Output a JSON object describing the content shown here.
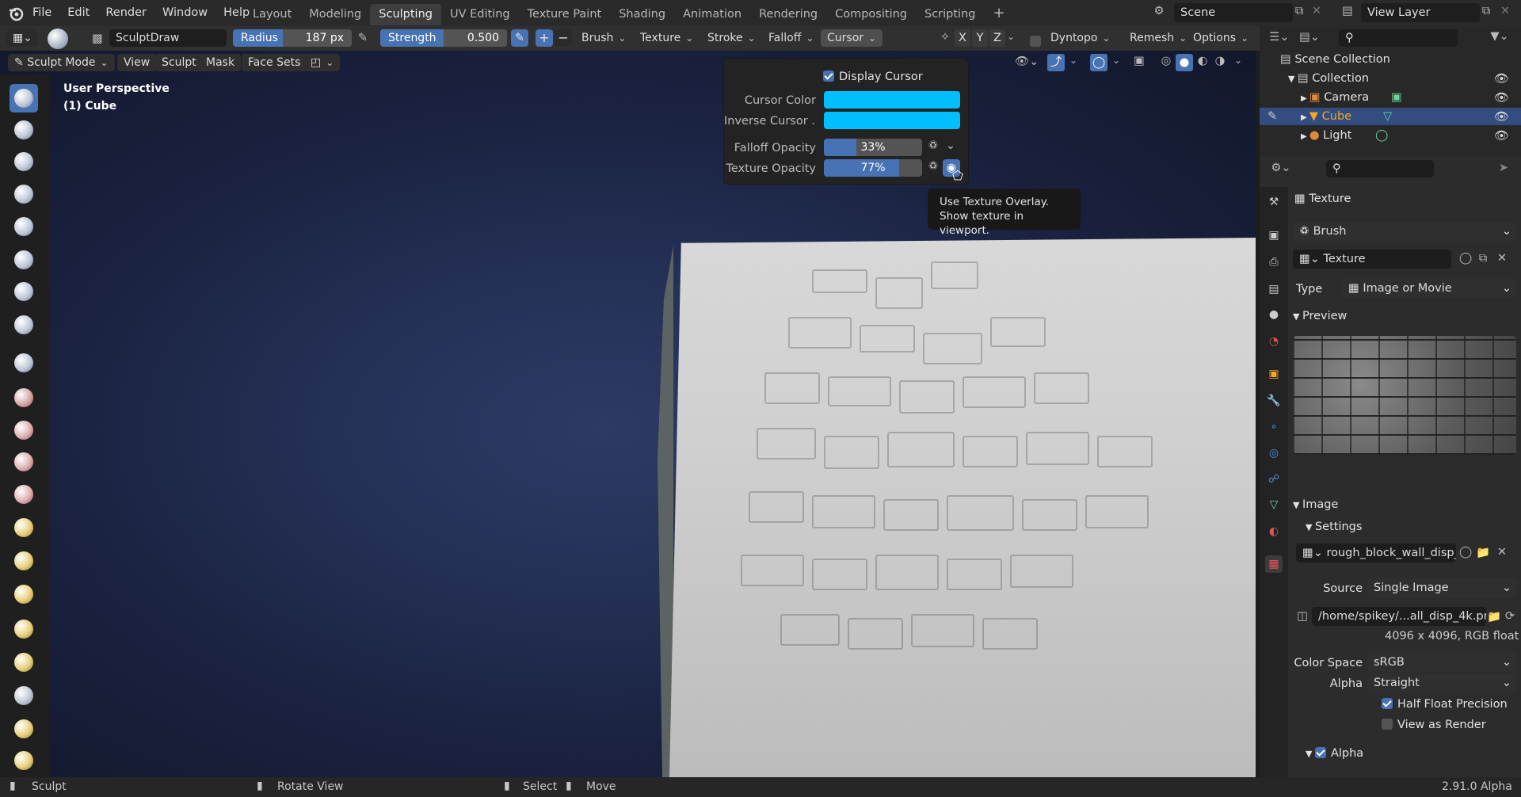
{
  "topbar": {
    "menus": [
      "File",
      "Edit",
      "Render",
      "Window",
      "Help"
    ],
    "workspaces": [
      "Layout",
      "Modeling",
      "Sculpting",
      "UV Editing",
      "Texture Paint",
      "Shading",
      "Animation",
      "Rendering",
      "Compositing",
      "Scripting"
    ],
    "active_workspace": "Sculpting",
    "scene": "Scene",
    "view_layer": "View Layer"
  },
  "toolbar": {
    "brush_name": "SculptDraw",
    "radius_label": "Radius",
    "radius_value": "187 px",
    "strength_label": "Strength",
    "strength_value": "0.500",
    "menus": [
      "Brush",
      "Texture",
      "Stroke",
      "Falloff",
      "Cursor"
    ],
    "axes": [
      "X",
      "Y",
      "Z"
    ],
    "dyntopo": "Dyntopo",
    "remesh": "Remesh",
    "options": "Options"
  },
  "header2": {
    "mode": "Sculpt Mode",
    "menus": [
      "View",
      "Sculpt",
      "Mask",
      "Face Sets"
    ]
  },
  "viewport": {
    "perspective": "User Perspective",
    "object": "(1) Cube"
  },
  "cursor_popup": {
    "display_cursor": "Display Cursor",
    "cursor_color_label": "Cursor Color",
    "inverse_label": "Inverse Cursor ...",
    "falloff_label": "Falloff Opacity",
    "falloff_value": "33%",
    "falloff_fraction": 0.33,
    "texture_label": "Texture Opacity",
    "texture_value": "77%",
    "texture_fraction": 0.77,
    "cursor_color": "#00bfff"
  },
  "tooltip": {
    "line1": "Use Texture Overlay.",
    "line2": "Show texture in viewport."
  },
  "outliner": {
    "scene_collection": "Scene Collection",
    "collection": "Collection",
    "items": [
      "Camera",
      "Cube",
      "Light"
    ]
  },
  "properties": {
    "header": "Texture",
    "brush_context": "Brush",
    "texture_name": "Texture",
    "type_label": "Type",
    "type_value": "Image or Movie",
    "preview": "Preview",
    "image_section": "Image",
    "settings_section": "Settings",
    "image_name": "rough_block_wall_disp_...",
    "source_label": "Source",
    "source_value": "Single Image",
    "filepath": "/home/spikey/...all_disp_4k.png",
    "resolution": "4096 x 4096,  RGB float",
    "colorspace_label": "Color Space",
    "colorspace_value": "sRGB",
    "alpha_label": "Alpha",
    "alpha_value": "Straight",
    "half_float": "Half Float Precision",
    "view_as_render": "View as Render",
    "alpha_section": "Alpha"
  },
  "statusbar": {
    "sculpt": "Sculpt",
    "rotate": "Rotate View",
    "select": "Select",
    "move": "Move",
    "version": "2.91.0 Alpha"
  },
  "colors": {
    "accent": "#4772b3",
    "header": "#2a2a2a",
    "panel": "#2c2c2c",
    "active_object": "#f5a623"
  }
}
